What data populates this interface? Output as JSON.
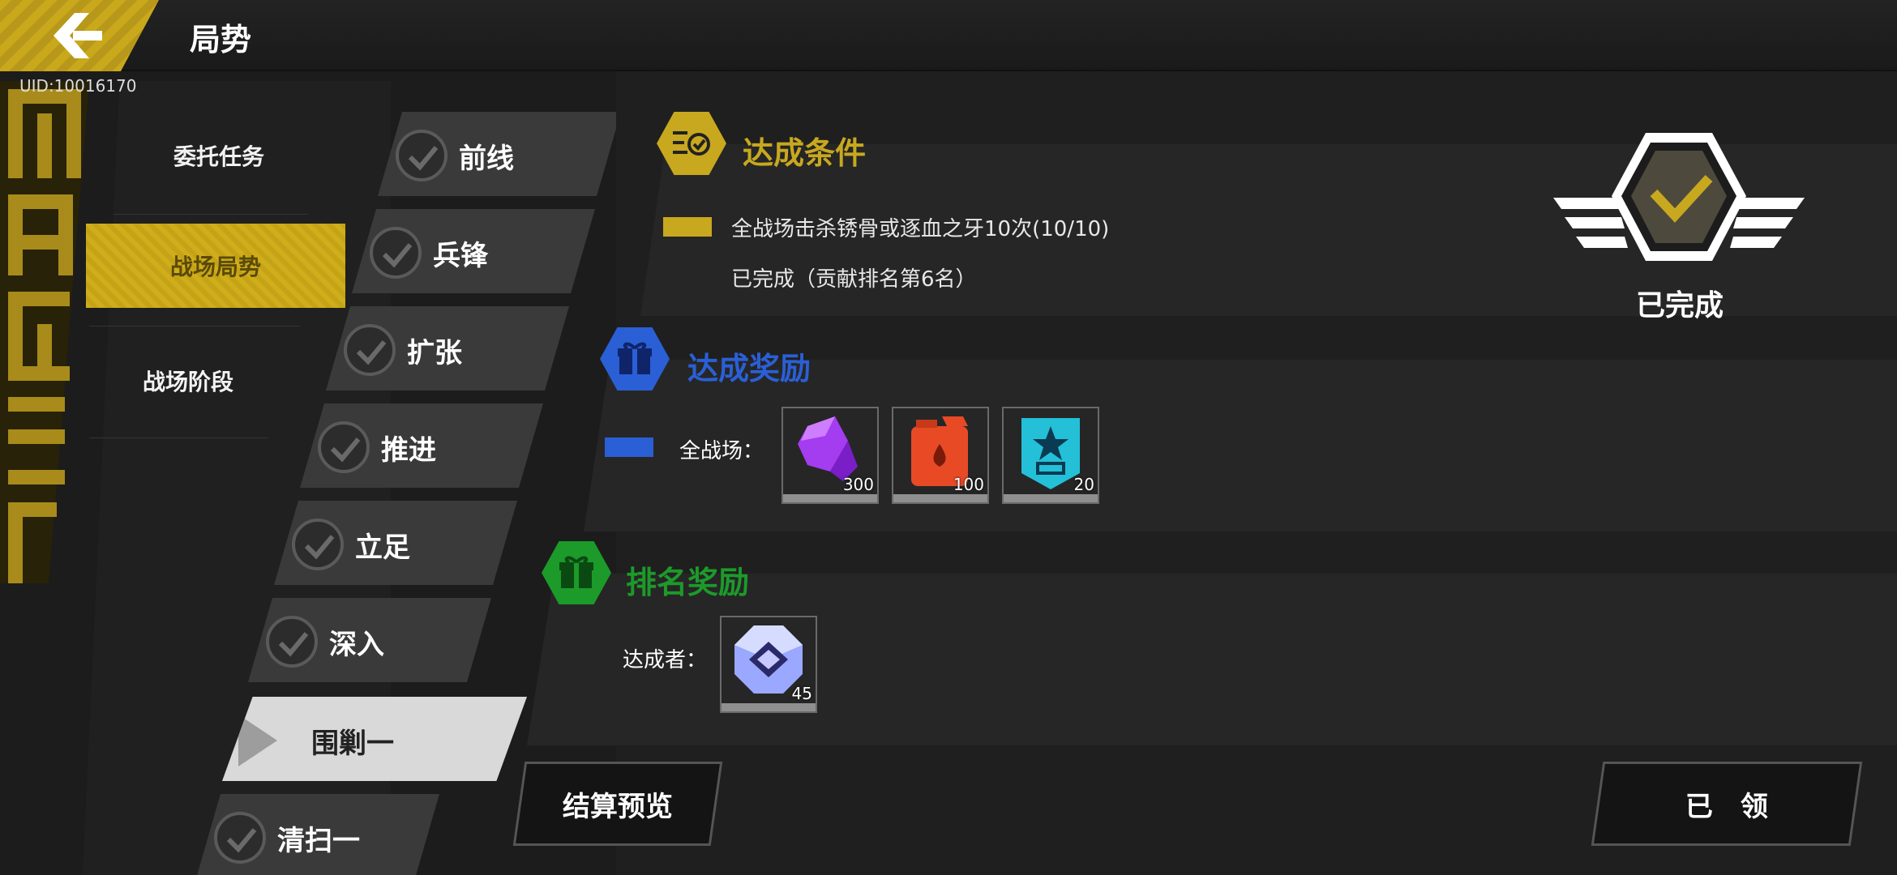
{
  "header": {
    "title": "局势",
    "uid": "UID:10016170"
  },
  "categories": [
    {
      "label": "委托任务",
      "active": false
    },
    {
      "label": "战场局势",
      "active": true
    },
    {
      "label": "战场阶段",
      "active": false
    }
  ],
  "stages": [
    {
      "label": "前线",
      "completed": true
    },
    {
      "label": "兵锋",
      "completed": true
    },
    {
      "label": "扩张",
      "completed": true
    },
    {
      "label": "推进",
      "completed": true
    },
    {
      "label": "立足",
      "completed": true
    },
    {
      "label": "深入",
      "completed": true
    },
    {
      "label": "围剿一",
      "completed": false,
      "active": true
    },
    {
      "label": "清扫一",
      "completed": true
    }
  ],
  "condition": {
    "title": "达成条件",
    "text": "全战场击杀锈骨或逐血之牙10次(10/10)",
    "status": "已完成（贡献排名第6名）"
  },
  "reward": {
    "title": "达成奖励",
    "label": "全战场：",
    "items": [
      {
        "icon": "purple-crystal-icon",
        "qty": "300"
      },
      {
        "icon": "fuel-can-icon",
        "qty": "100"
      },
      {
        "icon": "star-badge-icon",
        "qty": "20"
      }
    ]
  },
  "rank_reward": {
    "title": "排名奖励",
    "label": "达成者：",
    "items": [
      {
        "icon": "diamond-gem-icon",
        "qty": "45"
      }
    ]
  },
  "status_badge": {
    "label": "已完成"
  },
  "buttons": {
    "preview": "结算预览",
    "claimed": "已　领"
  },
  "colors": {
    "gold": "#c8a81e",
    "blue": "#2a5fd6",
    "green": "#1c9a2a"
  }
}
